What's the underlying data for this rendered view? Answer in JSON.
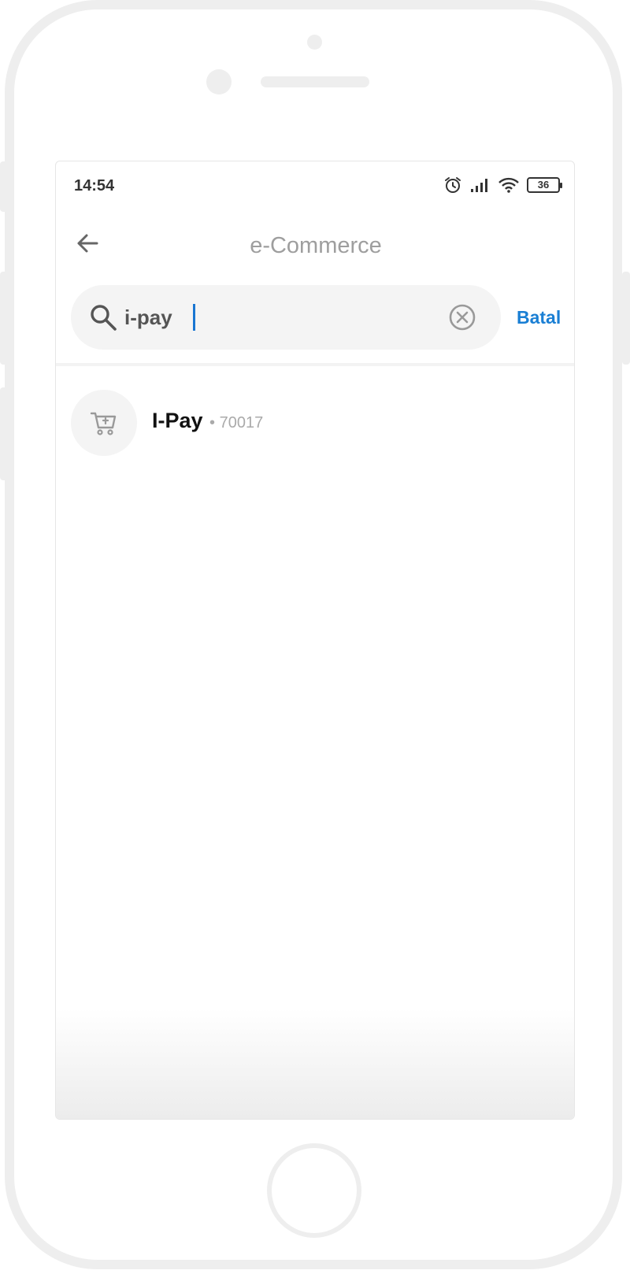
{
  "status_bar": {
    "time": "14:54",
    "battery": "36"
  },
  "header": {
    "title": "e-Commerce"
  },
  "search": {
    "value": "i-pay",
    "cancel_label": "Batal"
  },
  "results": [
    {
      "name": "I-Pay",
      "separator": "•",
      "code": "70017"
    }
  ],
  "colors": {
    "accent": "#1a7fd4",
    "caret": "#1976d2",
    "frame": "#eeeeee"
  },
  "icons": [
    "back-arrow-icon",
    "search-icon",
    "clear-icon",
    "cart-icon",
    "alarm-icon",
    "signal-icon",
    "wifi-icon",
    "battery-icon"
  ]
}
